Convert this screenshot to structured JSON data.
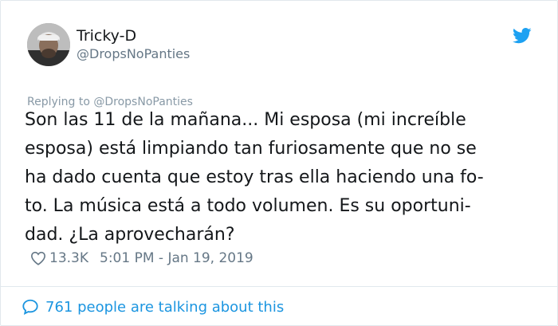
{
  "author": {
    "display_name": "Tricky-D",
    "handle": "@DropsNoPanties"
  },
  "icons": {
    "avatar": "avatar-photo",
    "brand": "twitter-bird-icon",
    "like": "heart-icon",
    "conversation": "speech-bubble-icon"
  },
  "tweet": {
    "replying_to": "Replying to @DropsNoPanties",
    "lines": [
      "Son las 11 de la mañana... Mi esposa (mi increíble",
      "esposa) está limpiando tan furiosamente que no se",
      "ha dado cuenta que estoy tras ella haciendo una fo-",
      "to. La música está a todo volumen. Es su oportuni-",
      "dad. ¿La aprovecharán?"
    ],
    "likes": "13.3K",
    "timestamp": "5:01 PM - Jan 19, 2019"
  },
  "footer": {
    "conversation_text": "761 people are talking about this"
  },
  "colors": {
    "brand_blue": "#1da1f2",
    "link_blue": "#1b95e0",
    "secondary_text": "#657786",
    "divider": "#e1e8ed"
  }
}
